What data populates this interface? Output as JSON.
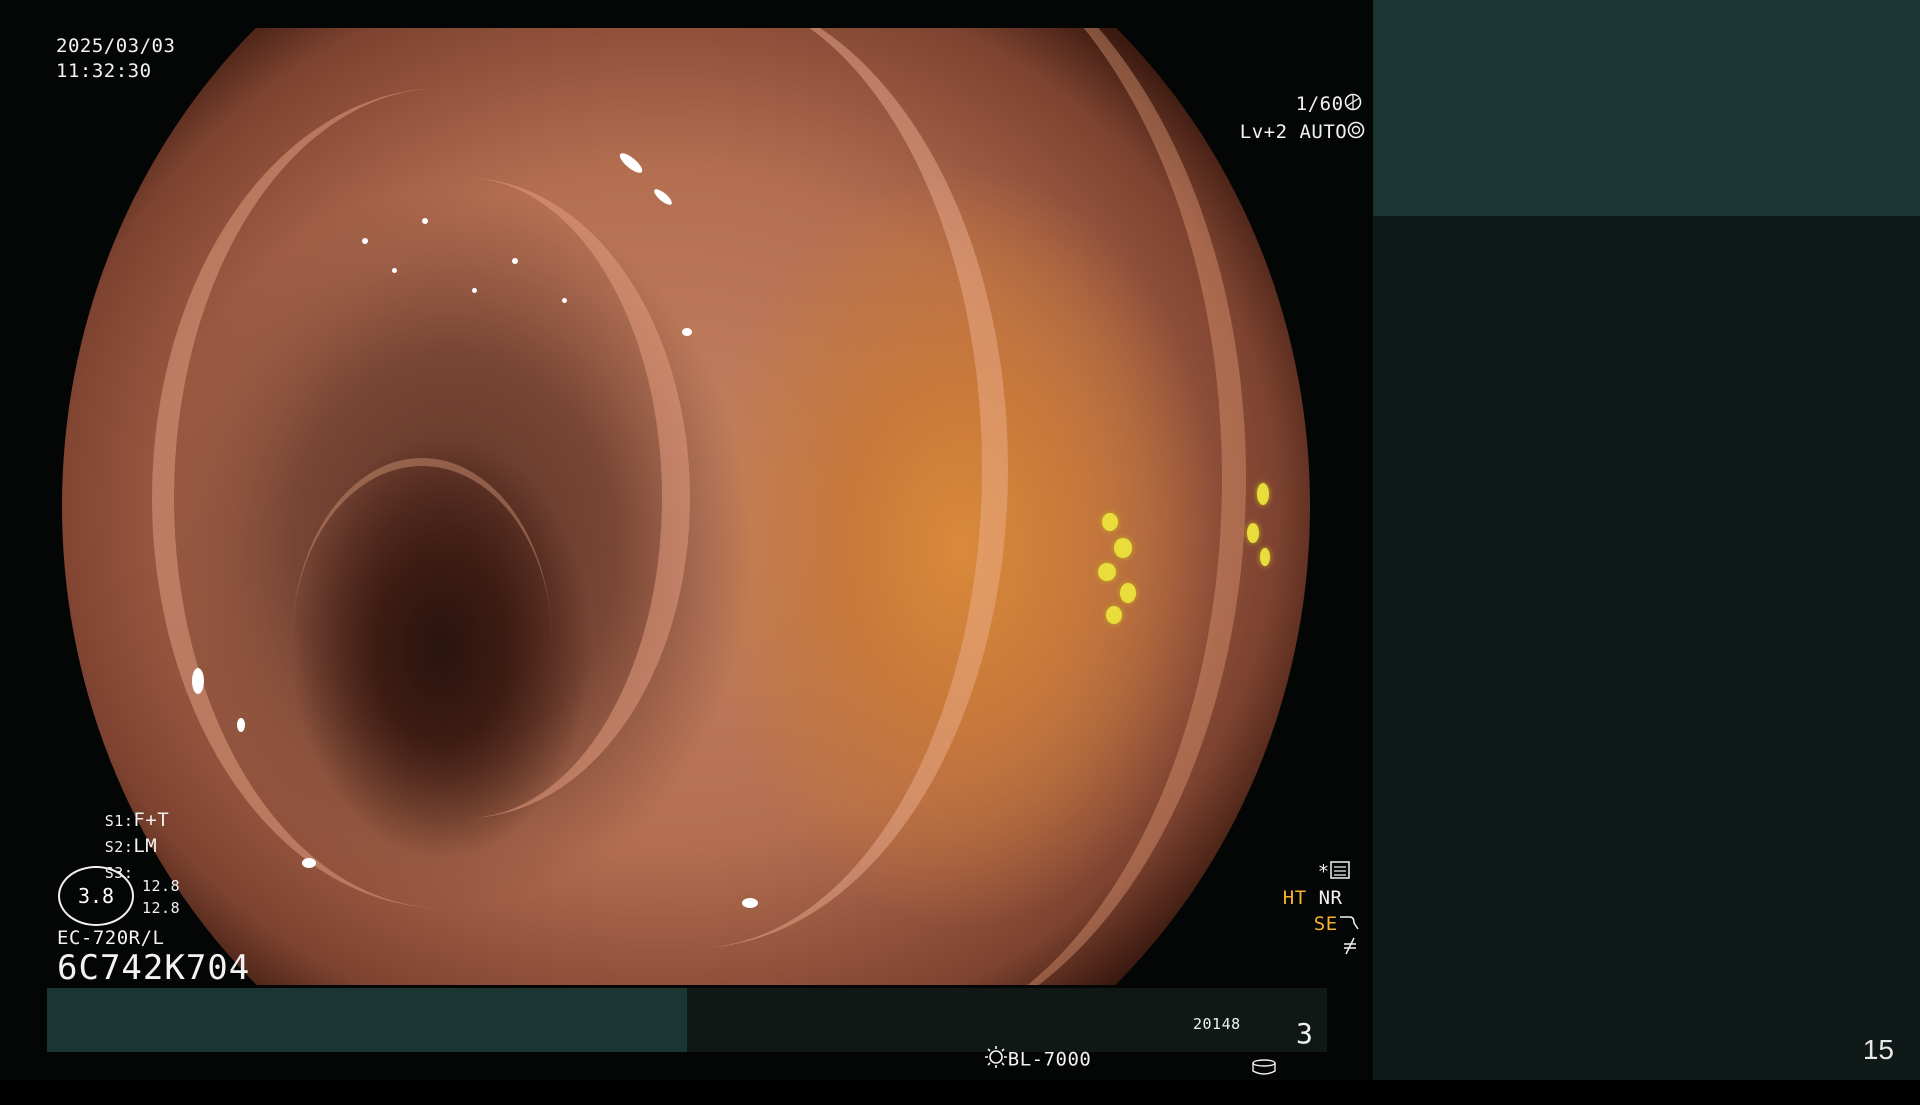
{
  "osd": {
    "date": "2025/03/03",
    "time": "11:32:30",
    "shutter": "1/60",
    "level": "Lv+2",
    "iris": "AUTO",
    "s1_label": "S1:",
    "s1_value": "F+T",
    "s2_label": "S2:",
    "s2_value": "LM",
    "s3_label": "S3:",
    "dial_value": "3.8",
    "dial_top": "12.8",
    "dial_bottom": "12.8",
    "scope_model": "EC-720R/L",
    "serial": "6C742K704",
    "star": "*",
    "ht": "HT",
    "nr": "NR",
    "se": "SE",
    "light_source": "BL-7000",
    "counter_small": "20148",
    "counter_big": "3"
  },
  "side_panel": {
    "page_number": "15"
  },
  "colors": {
    "screen_bg": "#040606",
    "teal_block": "#1a3532",
    "panel_bg": "#0f1a18",
    "osd_text": "#f2f2f2",
    "osd_orange": "#f7b22a"
  },
  "icons": [
    "shutter-icon",
    "iris-icon",
    "settings-icon",
    "enhance-icon",
    "freeze-icon",
    "lamp-icon",
    "storage-icon"
  ]
}
